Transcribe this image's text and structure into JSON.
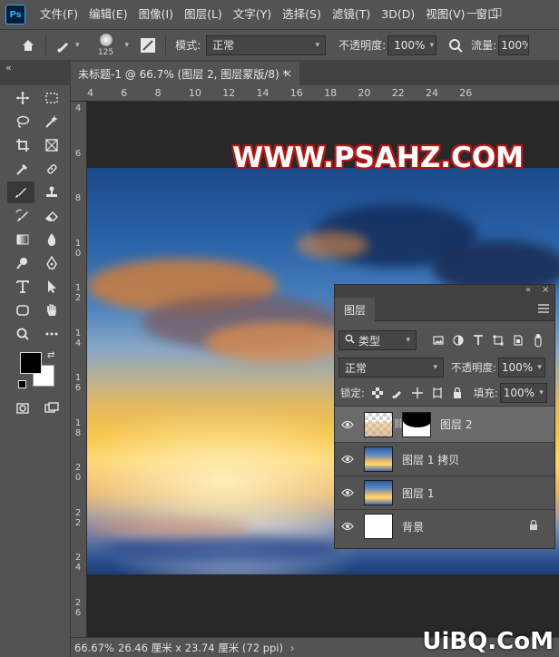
{
  "app": {
    "logo": "Ps"
  },
  "menu": [
    "文件(F)",
    "编辑(E)",
    "图像(I)",
    "图层(L)",
    "文字(Y)",
    "选择(S)",
    "滤镜(T)",
    "3D(D)",
    "视图(V)",
    "窗口"
  ],
  "window_controls": {
    "minimize": "—",
    "maximize": "☐"
  },
  "options": {
    "brush_size": "125",
    "mode_label": "模式:",
    "mode_value": "正常",
    "opacity_label": "不透明度:",
    "opacity_value": "100%",
    "flow_label": "流量:",
    "flow_value": "100%"
  },
  "tab": {
    "title": "未标题-1 @ 66.7% (图层 2, 图层蒙版/8) *",
    "close": "×",
    "collapse": "«"
  },
  "rulers": {
    "top": [
      "4",
      "6",
      "8",
      "10",
      "12",
      "14",
      "16",
      "18",
      "20",
      "22",
      "24",
      "26"
    ],
    "left": [
      "4",
      "6",
      "8",
      "10",
      "12",
      "14",
      "16",
      "18",
      "20",
      "22",
      "24",
      "26"
    ]
  },
  "watermark": "WWW.PSAHZ.COM",
  "status": {
    "zoom": "66.67%",
    "doc_info": "26.46 厘米 x 23.74 厘米 (72 ppi)",
    "arrow": "›"
  },
  "site_mark": "UiBQ.CoM",
  "layers_panel": {
    "collapse": "«",
    "close": "×",
    "tab_label": "图层",
    "filter_value": "类型",
    "blend_mode": "正常",
    "opacity_label": "不透明度:",
    "opacity_value": "100%",
    "lock_label": "锁定:",
    "fill_label": "填充:",
    "fill_value": "100%",
    "layers": [
      {
        "name": "图层 2",
        "selected": true,
        "has_mask": true
      },
      {
        "name": "图层 1 拷贝",
        "selected": false,
        "has_mask": false
      },
      {
        "name": "图层 1",
        "selected": false,
        "has_mask": false
      },
      {
        "name": "背景",
        "selected": false,
        "has_mask": false,
        "locked": true
      }
    ]
  },
  "colors": {
    "ui_panel": "#535353",
    "ui_dark": "#424242",
    "canvas_bg": "#282828",
    "foreground": "#000000",
    "background": "#ffffff",
    "watermark_outline": "#b01818"
  }
}
